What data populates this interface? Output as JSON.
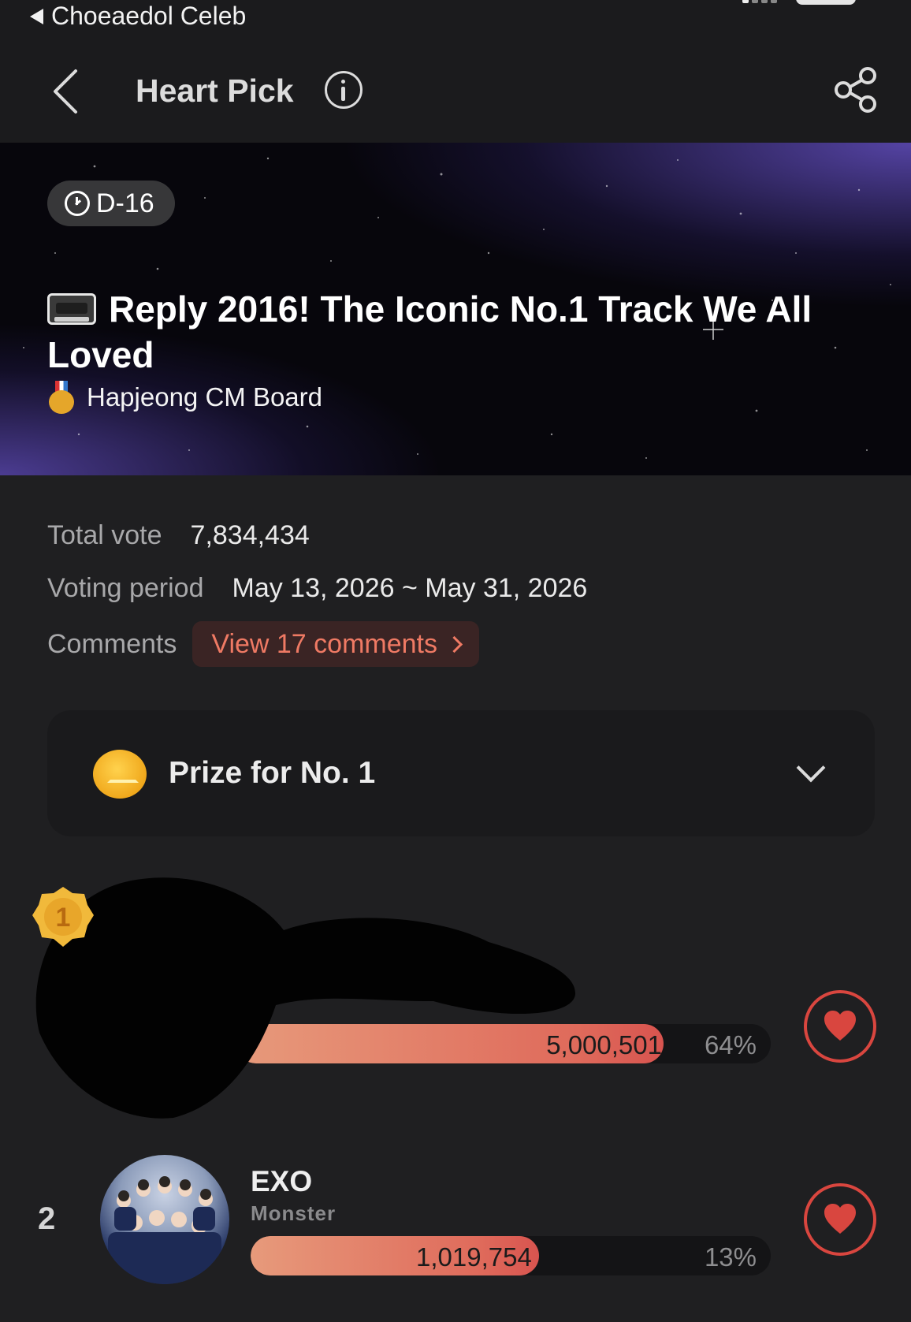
{
  "status_bar": {
    "back_app_label": "Choeaedol Celeb"
  },
  "header": {
    "title": "Heart Pick",
    "back_icon": "chevron-left-icon",
    "info_icon": "info-icon",
    "share_icon": "share-icon"
  },
  "banner": {
    "dday": "D-16",
    "title": "Reply 2016! The Iconic No.1 Track We All Loved",
    "title_icon": "cassette-tape-icon",
    "subtitle": "Hapjeong CM Board",
    "subtitle_icon": "medal-icon"
  },
  "info": {
    "total_vote_label": "Total vote",
    "total_vote_value": "7,834,434",
    "period_label": "Voting period",
    "period_value": "May 13, 2026 ~ May 31, 2026",
    "comments_label": "Comments",
    "comments_link": "View 17 comments"
  },
  "prize": {
    "label": "Prize for No. 1",
    "icon": "coin-crown-icon"
  },
  "rankings": [
    {
      "rank": "1",
      "name": "",
      "song": "",
      "votes": "5,000,501",
      "percent": "64%",
      "share": 0.64
    },
    {
      "rank": "2",
      "name": "EXO",
      "song": "Monster",
      "votes": "1,019,754",
      "percent": "13%",
      "share": 0.13
    }
  ],
  "colors": {
    "accent": "#df6a5b",
    "heart": "#d9463f",
    "background": "#1f1f21"
  }
}
